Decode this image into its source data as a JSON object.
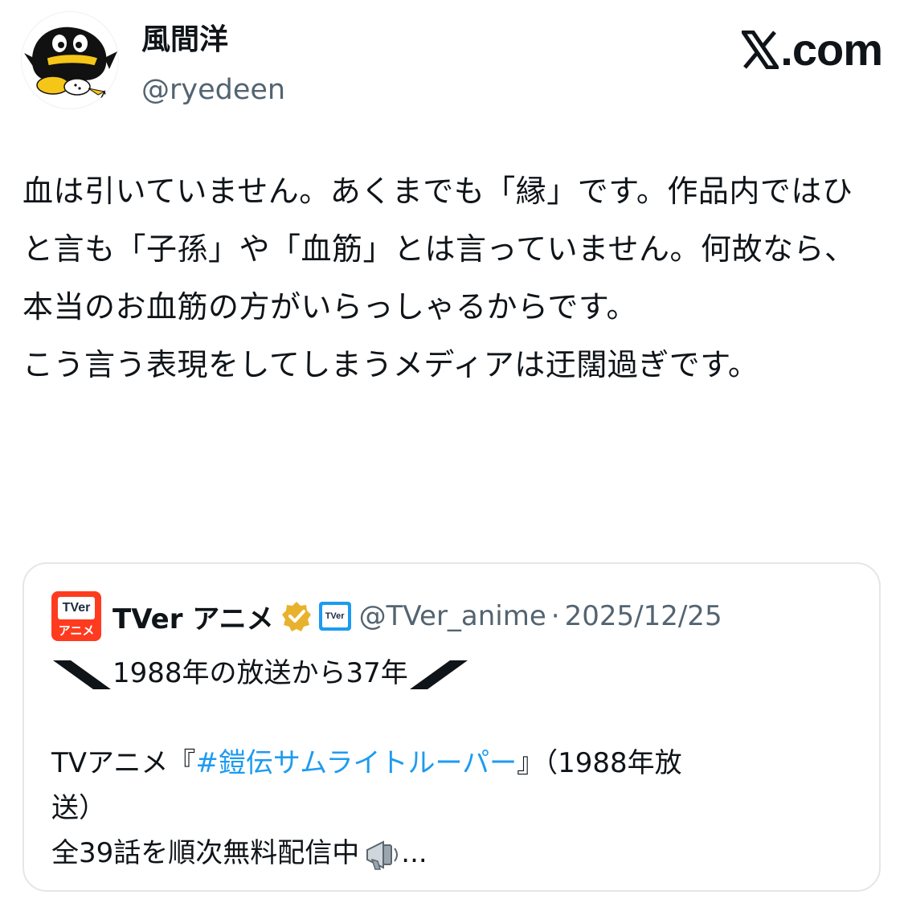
{
  "author": {
    "display_name": "風間洋",
    "handle": "@ryedeen",
    "avatar_icon": "penguin-avatar-icon"
  },
  "site": {
    "logo_icon": "x-logo-icon",
    "logo_text": ".com"
  },
  "tweet": {
    "text": "血は引いていません。あくまでも「縁」です。作品内ではひと言も「子孫」や「血筋」とは言っていません。何故なら、本当のお血筋の方がいらっしゃるからです。\nこう言う表現をしてしまうメディアは迂闊過ぎです。"
  },
  "quote": {
    "avatar_logo_text": "TVer",
    "avatar_sub_text": "アニメ",
    "display_name": "TVer アニメ",
    "verified_icon": "gold-verified-badge-icon",
    "affiliate_icon": "tver-affiliate-badge-icon",
    "affiliate_text": "TVer",
    "handle": "@TVer_anime",
    "separator": "·",
    "date": "2025/12/25",
    "line1": "1988年の放送から37年",
    "line2_prefix": "TVアニメ『",
    "line2_hashtag": "#鎧伝サムライトルーパー",
    "line2_suffix": "』（1988年放",
    "line3": "送）",
    "line4": "全39話を順次無料配信中",
    "line4_icon": "megaphone-icon",
    "line4_suffix": "..."
  },
  "colors": {
    "text": "#0f1419",
    "secondary": "#536471",
    "link": "#1d9bf0",
    "card_border": "#e3e7ea",
    "tver_red": "#ff3b1f"
  }
}
